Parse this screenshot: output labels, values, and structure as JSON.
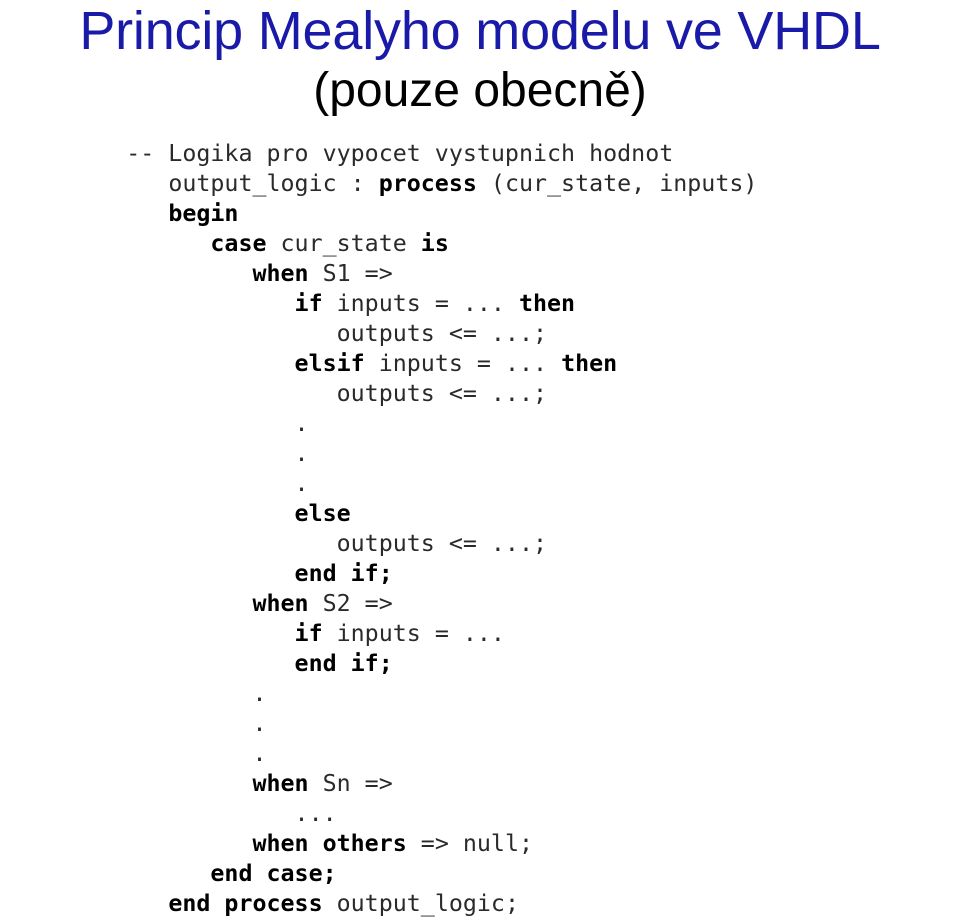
{
  "slide": {
    "title": "Princip Mealyho modelu ve VHDL",
    "subtitle": "(pouze obecně)",
    "title_color": "#1a1aa8",
    "subtitle_color": "#010101",
    "background_color": "#ffffff"
  },
  "code": {
    "language": "VHDL",
    "indent_unit_chars": 3,
    "lines": [
      {
        "indent": 9,
        "tokens": [
          {
            "t": "-- Logika pro vypocet vystupnich hodnot",
            "k": false
          }
        ]
      },
      {
        "indent": 12,
        "tokens": [
          {
            "t": "output_logic : ",
            "k": false
          },
          {
            "t": "process",
            "k": true
          },
          {
            "t": " (cur_state, inputs)",
            "k": false
          }
        ]
      },
      {
        "indent": 12,
        "tokens": [
          {
            "t": "begin",
            "k": true
          }
        ]
      },
      {
        "indent": 15,
        "tokens": [
          {
            "t": "case",
            "k": true
          },
          {
            "t": " cur_state ",
            "k": false
          },
          {
            "t": "is",
            "k": true
          }
        ]
      },
      {
        "indent": 18,
        "tokens": [
          {
            "t": "when",
            "k": true
          },
          {
            "t": " S1 =>",
            "k": false
          }
        ]
      },
      {
        "indent": 21,
        "tokens": [
          {
            "t": "if",
            "k": true
          },
          {
            "t": " inputs = ... ",
            "k": false
          },
          {
            "t": "then",
            "k": true
          }
        ]
      },
      {
        "indent": 24,
        "tokens": [
          {
            "t": "outputs <= ...;",
            "k": false
          }
        ]
      },
      {
        "indent": 21,
        "tokens": [
          {
            "t": "elsif",
            "k": true
          },
          {
            "t": " inputs = ... ",
            "k": false
          },
          {
            "t": "then",
            "k": true
          }
        ]
      },
      {
        "indent": 24,
        "tokens": [
          {
            "t": "outputs <= ...;",
            "k": false
          }
        ]
      },
      {
        "indent": 21,
        "tokens": [
          {
            "t": ".",
            "k": false
          }
        ]
      },
      {
        "indent": 21,
        "tokens": [
          {
            "t": ".",
            "k": false
          }
        ]
      },
      {
        "indent": 21,
        "tokens": [
          {
            "t": ".",
            "k": false
          }
        ]
      },
      {
        "indent": 21,
        "tokens": [
          {
            "t": "else",
            "k": true
          }
        ]
      },
      {
        "indent": 24,
        "tokens": [
          {
            "t": "outputs <= ...;",
            "k": false
          }
        ]
      },
      {
        "indent": 21,
        "tokens": [
          {
            "t": "end if;",
            "k": true
          }
        ]
      },
      {
        "indent": 18,
        "tokens": [
          {
            "t": "when",
            "k": true
          },
          {
            "t": " S2 =>",
            "k": false
          }
        ]
      },
      {
        "indent": 21,
        "tokens": [
          {
            "t": "if",
            "k": true
          },
          {
            "t": " inputs = ...",
            "k": false
          }
        ]
      },
      {
        "indent": 21,
        "tokens": [
          {
            "t": "end if;",
            "k": true
          }
        ]
      },
      {
        "indent": 18,
        "tokens": [
          {
            "t": ".",
            "k": false
          }
        ]
      },
      {
        "indent": 18,
        "tokens": [
          {
            "t": ".",
            "k": false
          }
        ]
      },
      {
        "indent": 18,
        "tokens": [
          {
            "t": ".",
            "k": false
          }
        ]
      },
      {
        "indent": 18,
        "tokens": [
          {
            "t": "when",
            "k": true
          },
          {
            "t": " Sn =>",
            "k": false
          }
        ]
      },
      {
        "indent": 21,
        "tokens": [
          {
            "t": "...",
            "k": false
          }
        ]
      },
      {
        "indent": 18,
        "tokens": [
          {
            "t": "when others",
            "k": true
          },
          {
            "t": " => null;",
            "k": false
          }
        ]
      },
      {
        "indent": 15,
        "tokens": [
          {
            "t": "end case;",
            "k": true
          }
        ]
      },
      {
        "indent": 12,
        "tokens": [
          {
            "t": "end process",
            "k": true
          },
          {
            "t": " output_logic;",
            "k": false
          }
        ]
      }
    ]
  }
}
